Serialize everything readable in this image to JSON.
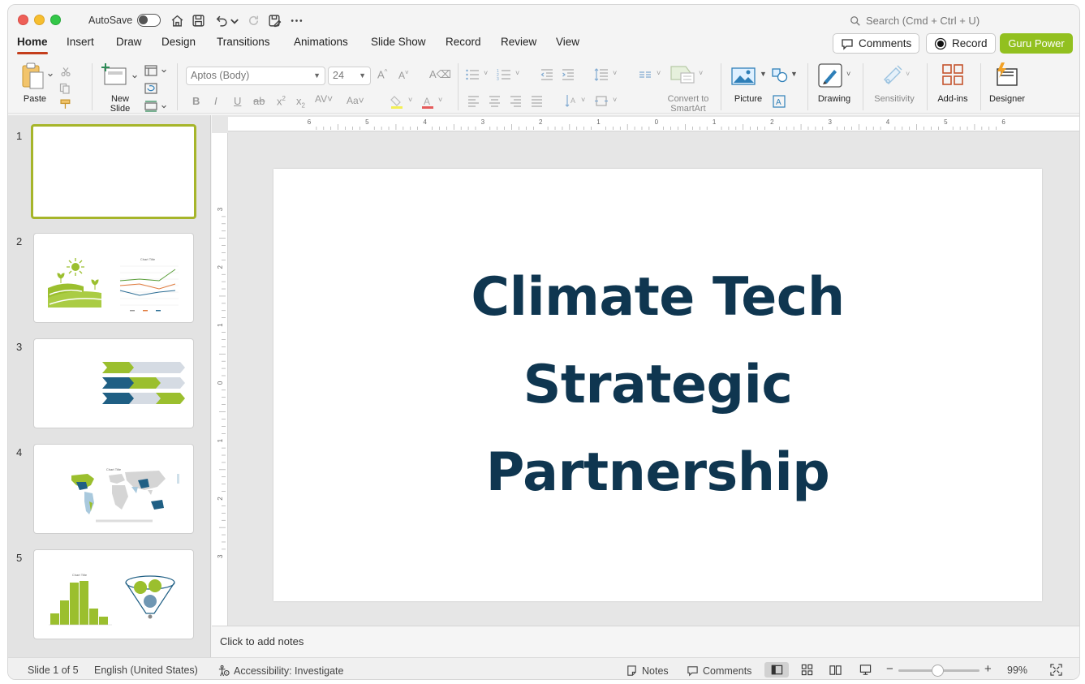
{
  "titlebar": {
    "autosave_label": "AutoSave",
    "search_placeholder": "Search (Cmd + Ctrl + U)"
  },
  "tabs": [
    "Home",
    "Insert",
    "Draw",
    "Design",
    "Transitions",
    "Animations",
    "Slide Show",
    "Record",
    "Review",
    "View"
  ],
  "active_tab": "Home",
  "top_buttons": {
    "comments": "Comments",
    "record": "Record",
    "guru": "Guru Power"
  },
  "ribbon": {
    "paste": "Paste",
    "new_slide_line1": "New",
    "new_slide_line2": "Slide",
    "font_name": "Aptos (Body)",
    "font_size": "24",
    "convert_line1": "Convert to",
    "convert_line2": "SmartArt",
    "picture": "Picture",
    "drawing": "Drawing",
    "sensitivity": "Sensitivity",
    "addins": "Add-ins",
    "designer": "Designer"
  },
  "slides": [
    {
      "num": "1"
    },
    {
      "num": "2"
    },
    {
      "num": "3"
    },
    {
      "num": "4"
    },
    {
      "num": "5"
    }
  ],
  "thumb_chart_title": "Chart Title",
  "slide": {
    "title_line1": "Climate Tech",
    "title_line2": "Strategic",
    "title_line3": "Partnership",
    "title_color": "#0f3650"
  },
  "notes_placeholder": "Click to add notes",
  "ruler": {
    "h_labels": [
      "6",
      "5",
      "4",
      "3",
      "2",
      "1",
      "0",
      "1",
      "2",
      "3",
      "4",
      "5",
      "6"
    ],
    "v_labels": [
      "3",
      "2",
      "1",
      "0",
      "1",
      "2",
      "3"
    ]
  },
  "status": {
    "slide_info": "Slide 1 of 5",
    "language": "English (United States)",
    "accessibility": "Accessibility: Investigate",
    "notes": "Notes",
    "comments": "Comments",
    "zoom_minus": "−",
    "zoom_plus": "+",
    "zoom": "99%"
  },
  "colors": {
    "accent_tab": "#c43e1c",
    "guru_green": "#92c01f",
    "thumb_green": "#9bbf2e",
    "thumb_blue": "#1f5f84"
  }
}
